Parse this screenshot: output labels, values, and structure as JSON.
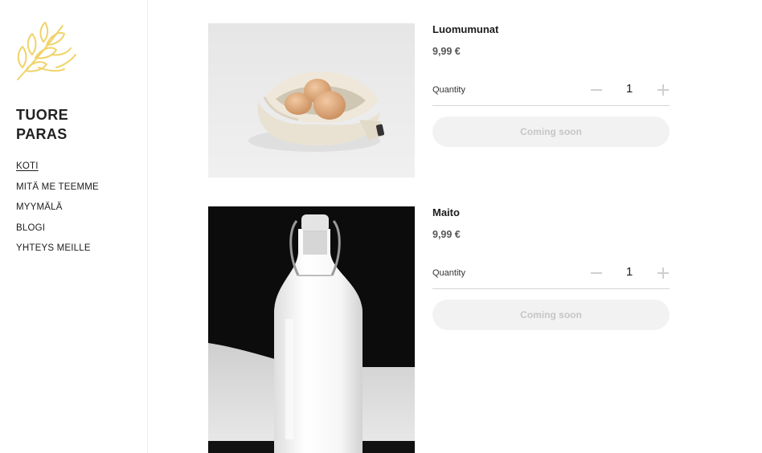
{
  "brand": {
    "line1": "TUORE",
    "line2": "PARAS",
    "logo_icon": "wheat-icon",
    "logo_color": "#f0d36a"
  },
  "nav": {
    "items": [
      {
        "label": "KOTI",
        "active": true
      },
      {
        "label": "MITÄ ME TEEMME"
      },
      {
        "label": "MYYMÄLÄ"
      },
      {
        "label": "BLOGI"
      },
      {
        "label": "YHTEYS MEILLE"
      }
    ]
  },
  "products": [
    {
      "name": "Luomumunat",
      "price": "9,99 €",
      "quantity_label": "Quantity",
      "quantity": "1",
      "button_label": "Coming soon",
      "image": "eggs-in-cloth-bag"
    },
    {
      "name": "Maito",
      "price": "9,99 €",
      "quantity_label": "Quantity",
      "quantity": "1",
      "button_label": "Coming soon",
      "image": "milk-bottle"
    }
  ]
}
